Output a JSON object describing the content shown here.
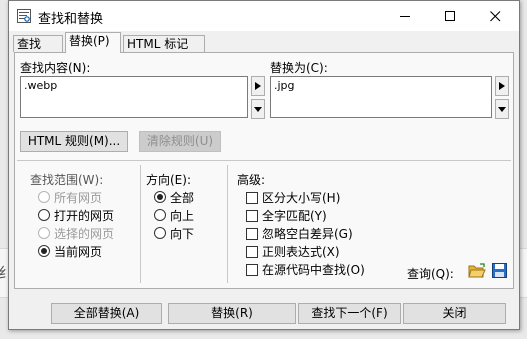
{
  "background": {
    "edge_char": "纟"
  },
  "window": {
    "title": "查找和替换"
  },
  "tabs": [
    {
      "label": "查找(D)",
      "active": false
    },
    {
      "label": "替换(P)",
      "active": true
    },
    {
      "label": "HTML 标记(L)",
      "active": false
    }
  ],
  "find": {
    "label": "查找内容(N):",
    "value": ".webp"
  },
  "replace": {
    "label": "替换为(C):",
    "value": ".jpg"
  },
  "buttons": {
    "html_rules": "HTML 规则(M)...",
    "clear_rules": "清除规则(U)"
  },
  "scope": {
    "label": "查找范围(W):",
    "options": [
      {
        "label": "所有网页",
        "checked": false,
        "enabled": false
      },
      {
        "label": "打开的网页",
        "checked": false,
        "enabled": true
      },
      {
        "label": "选择的网页",
        "checked": false,
        "enabled": false
      },
      {
        "label": "当前网页",
        "checked": true,
        "enabled": true
      }
    ]
  },
  "direction": {
    "label": "方向(E):",
    "options": [
      {
        "label": "全部",
        "checked": true
      },
      {
        "label": "向上",
        "checked": false
      },
      {
        "label": "向下",
        "checked": false
      }
    ]
  },
  "advanced": {
    "label": "高级:",
    "options": [
      {
        "label": "区分大小写(H)",
        "checked": false
      },
      {
        "label": "全字匹配(Y)",
        "checked": false
      },
      {
        "label": "忽略空白差异(G)",
        "checked": false
      },
      {
        "label": "正则表达式(X)",
        "checked": false
      },
      {
        "label": "在源代码中查找(O)",
        "checked": false
      }
    ]
  },
  "query": {
    "label": "查询(Q):"
  },
  "footer": {
    "replace_all": "全部替换(A)",
    "replace": "替换(R)",
    "find_next": "查找下一个(F)",
    "close": "关闭"
  },
  "colors": {
    "accent": "#0067c0",
    "folder": "#e8b53a",
    "disk": "#2a6fc7"
  }
}
